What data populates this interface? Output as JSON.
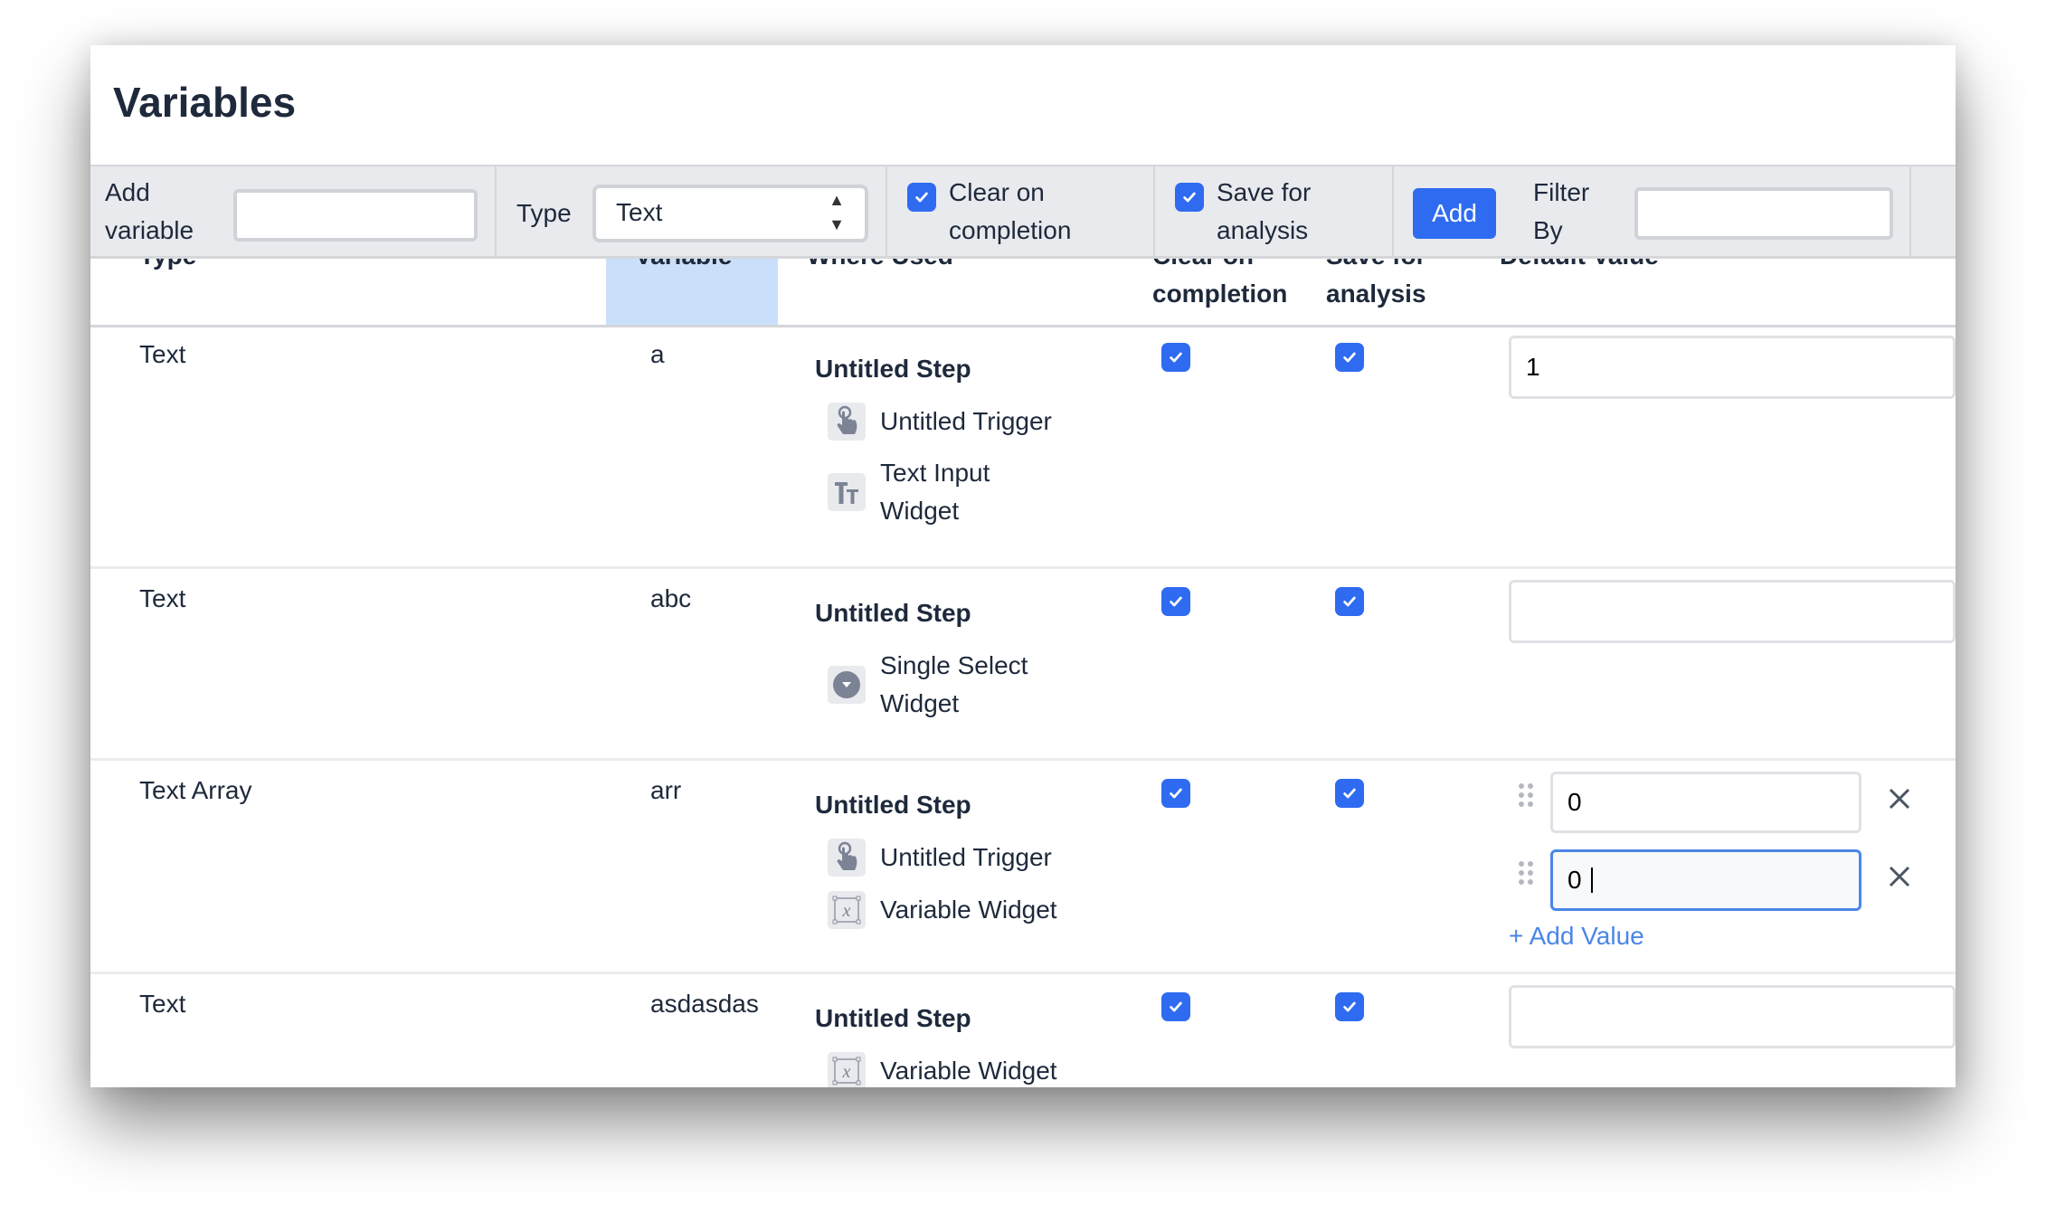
{
  "title": "Variables",
  "toolbar": {
    "add_variable_label": "Add variable",
    "add_variable_value": "",
    "type_label": "Type",
    "type_selected": "Text",
    "clear_on_completion_label": "Clear on completion",
    "clear_on_completion_checked": true,
    "save_for_analysis_label": "Save for analysis",
    "save_for_analysis_checked": true,
    "add_button": "Add",
    "filter_label": "Filter By",
    "filter_value": ""
  },
  "columns": [
    "Type",
    "Variable",
    "Where Used",
    "Clear on completion",
    "Save for analysis",
    "Default Value"
  ],
  "rows": [
    {
      "type": "Text",
      "variable": "a",
      "step": "Untitled Step",
      "uses": [
        {
          "icon": "pointer-hand-icon",
          "label": "Untitled Trigger"
        },
        {
          "icon": "text-input-icon",
          "label": "Text Input Widget"
        }
      ],
      "clear": true,
      "save": true,
      "default": "1"
    },
    {
      "type": "Text",
      "variable": "abc",
      "step": "Untitled Step",
      "uses": [
        {
          "icon": "single-select-icon",
          "label": "Single Select Widget"
        }
      ],
      "clear": true,
      "save": true,
      "default": ""
    },
    {
      "type": "Text Array",
      "variable": "arr",
      "step": "Untitled Step",
      "uses": [
        {
          "icon": "pointer-hand-icon",
          "label": "Untitled Trigger"
        },
        {
          "icon": "variable-widget-icon",
          "label": "Variable Widget"
        }
      ],
      "clear": true,
      "save": true,
      "default_values": [
        "0",
        "0"
      ],
      "add_value_label": "+ Add Value"
    },
    {
      "type": "Text",
      "variable": "asdasdas",
      "step": "Untitled Step",
      "uses": [
        {
          "icon": "variable-widget-icon",
          "label": "Variable Widget"
        }
      ],
      "clear": true,
      "save": true,
      "default": ""
    }
  ],
  "colors": {
    "accent": "#2f6bf0",
    "link": "#4a86e8",
    "toolbar_bg": "#e9eaee",
    "column_highlight": "#cadffa"
  }
}
